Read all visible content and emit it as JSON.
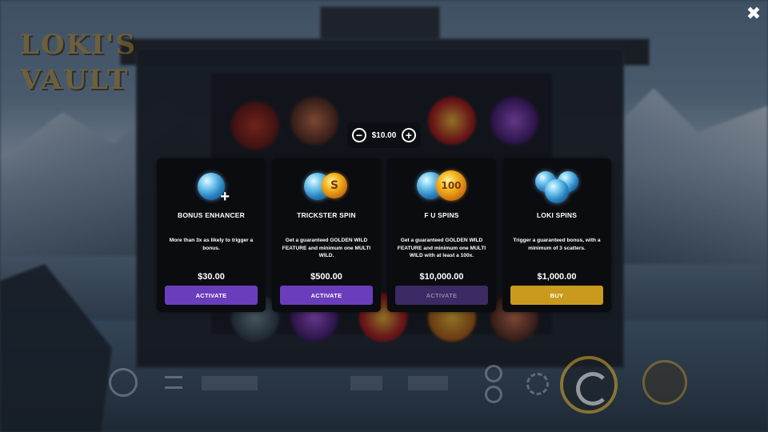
{
  "logo": {
    "line1": "LOKI'S",
    "line2": "VAULT"
  },
  "close": {
    "glyph": "✖"
  },
  "bet": {
    "minus": "−",
    "value": "$10.00",
    "plus": "+"
  },
  "cards": [
    {
      "title": "BONUS ENHANCER",
      "description": "More than 3x as likely to trigger a bonus.",
      "price": "$30.00",
      "button": "ACTIVATE",
      "button_state": "enabled",
      "icon": "blue-orb-plus-icon"
    },
    {
      "title": "TRICKSTER SPIN",
      "description": "Get a guaranteed GOLDEN WILD FEATURE and minimum one MULTI WILD.",
      "price": "$500.00",
      "button": "ACTIVATE",
      "button_state": "enabled",
      "icon": "orb-and-coin-icon"
    },
    {
      "title": "F U SPINS",
      "description": "Get a guaranteed GOLDEN WILD FEATURE and minimum one MULTI WILD with at least a 100x.",
      "price": "$10,000.00",
      "button": "ACTIVATE",
      "button_state": "disabled",
      "icon": "orb-and-100-coin-icon",
      "coin_label": "100"
    },
    {
      "title": "LOKI SPINS",
      "description": "Trigger a guaranteed bonus, with a minimum of 3 scatters.",
      "price": "$1,000.00",
      "button": "BUY",
      "button_state": "gold",
      "icon": "triple-blue-orbs-icon"
    }
  ],
  "colors": {
    "activate": "#6a3dbd",
    "activate_disabled": "#3b2a63",
    "buy": "#c99a1d",
    "card_bg": "#0b0c0f"
  }
}
